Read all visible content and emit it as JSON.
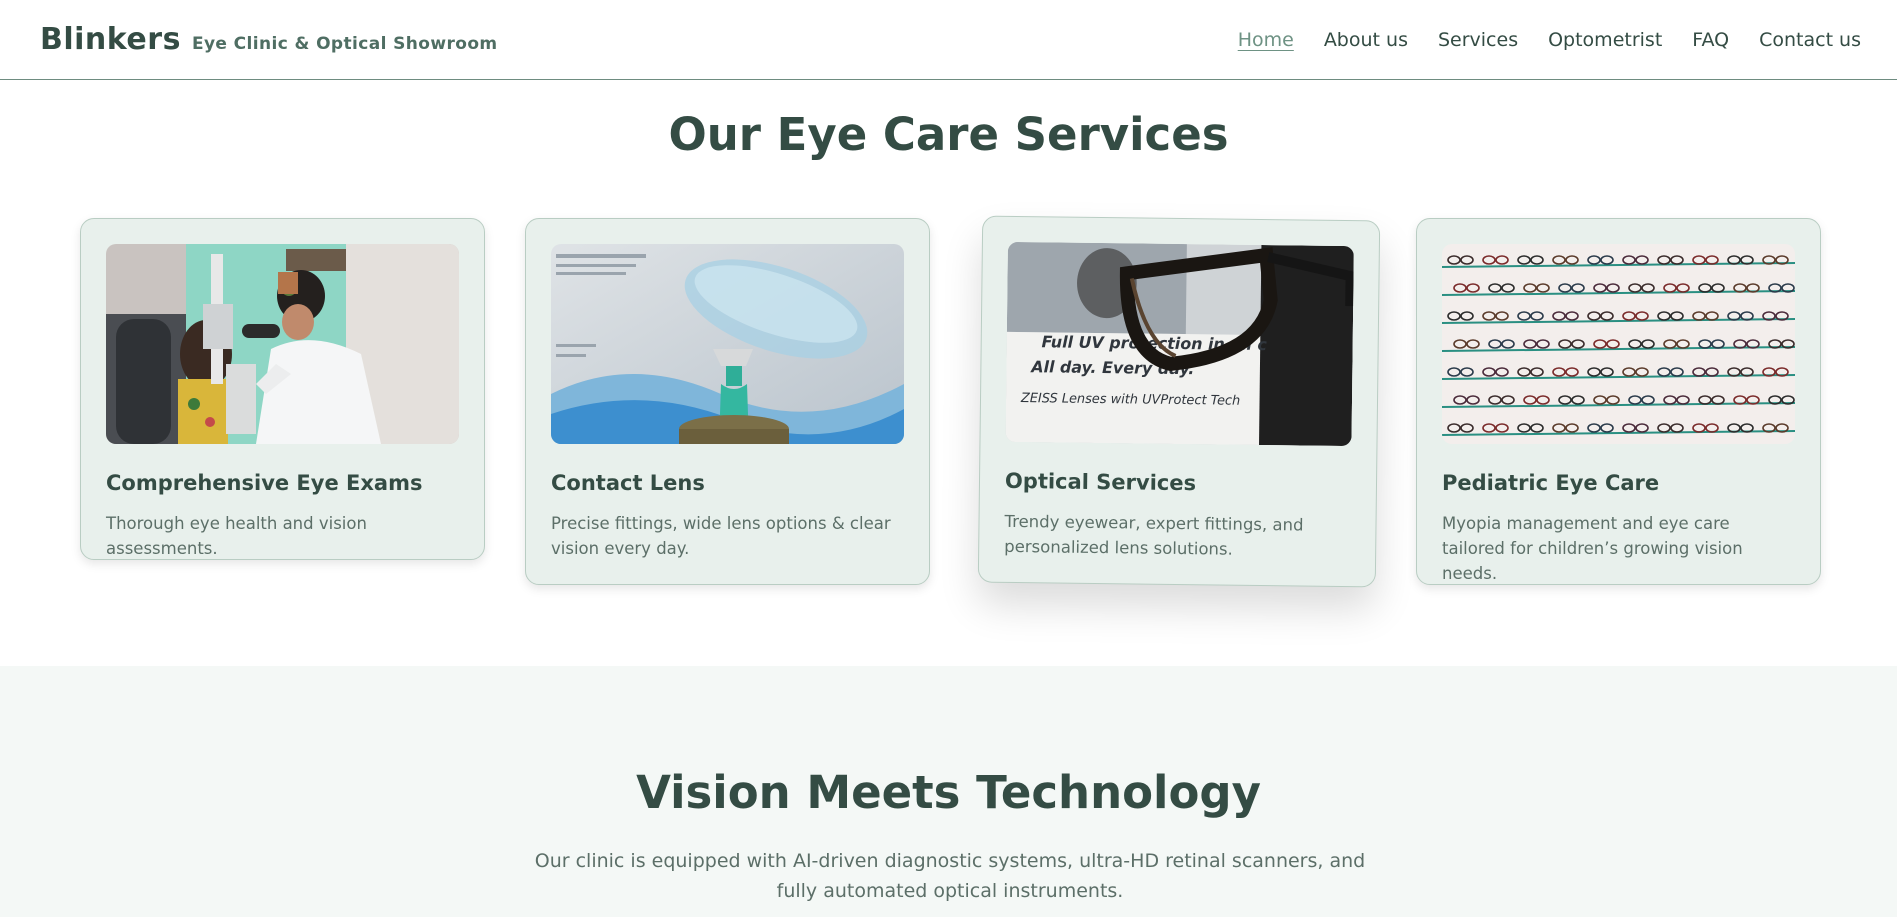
{
  "header": {
    "brand_name": "Blinkers",
    "brand_tagline": "Eye Clinic & Optical Showroom",
    "nav": [
      {
        "label": "Home",
        "active": true
      },
      {
        "label": "About us"
      },
      {
        "label": "Services"
      },
      {
        "label": "Optometrist"
      },
      {
        "label": "FAQ"
      },
      {
        "label": "Contact us"
      }
    ]
  },
  "services": {
    "title": "Our Eye Care Services",
    "cards": [
      {
        "title": "Comprehensive Eye Exams",
        "text": "Thorough eye health and vision assessments.",
        "image": "eye-exam-photo"
      },
      {
        "title": "Contact Lens",
        "text": "Precise fittings, wide lens options & clear vision every day.",
        "image": "contact-lens-photo"
      },
      {
        "title": "Optical Services",
        "text": "Trendy eyewear, expert fittings, and personalized lens solutions.",
        "image": "eyeglasses-photo",
        "image_text": [
          "Full UV protection in all c",
          "All day. Every day.",
          "ZEISS Lenses with UVProtect Tech"
        ]
      },
      {
        "title": "Pediatric Eye Care",
        "text": "Myopia management and eye care tailored for children’s growing vision needs.",
        "image": "frames-shelf-photo"
      }
    ]
  },
  "technology": {
    "title": "Vision Meets Technology",
    "text": "Our clinic is equipped with AI-driven diagnostic systems, ultra-HD retinal scanners, and fully automated optical instruments."
  },
  "colors": {
    "primary_text": "#344c44",
    "accent": "#6e9284",
    "card_bg": "#e8f0ec",
    "section_bg": "#f4f8f6"
  }
}
